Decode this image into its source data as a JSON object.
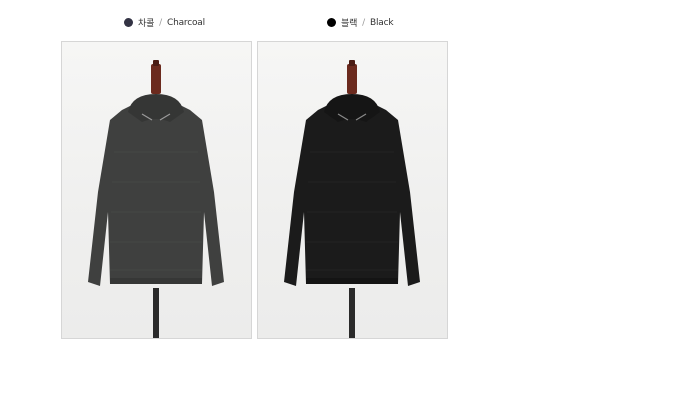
{
  "variants": [
    {
      "name_ko": "차콜",
      "separator": "/",
      "name_en": "Charcoal",
      "swatch_color": "#333344",
      "garment_color": "#3f403f",
      "image_subject": "charcoal hooded long-sleeve top on mannequin"
    },
    {
      "name_ko": "블랙",
      "separator": "/",
      "name_en": "Black",
      "swatch_color": "#000000",
      "garment_color": "#1b1b1b",
      "image_subject": "black hooded long-sleeve top on mannequin"
    }
  ]
}
